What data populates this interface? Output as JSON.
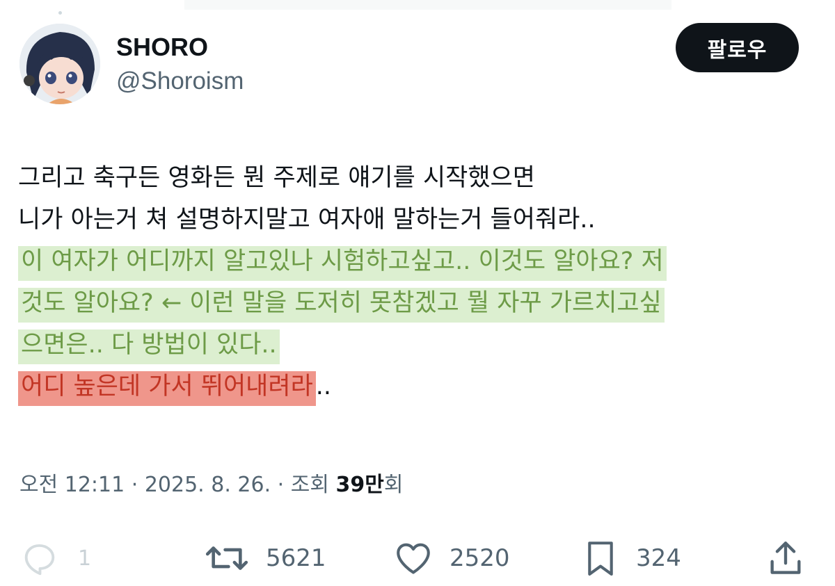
{
  "author": {
    "display_name": "SHORO",
    "handle": "@Shoroism"
  },
  "follow_button": {
    "label": "팔로우"
  },
  "tweet": {
    "lines": [
      {
        "text": "그리고 축구든 영화든 뭔 주제로 얘기를 시작했으면",
        "highlight": "none"
      },
      {
        "text": "니가 아는거 쳐 설명하지말고 여자애 말하는거 들어줘라..",
        "highlight": "none"
      },
      {
        "text": "이 여자가 어디까지 알고있나 시험하고싶고.. 이것도 알아요? 저",
        "highlight": "green"
      },
      {
        "text": "것도 알아요? ← 이런 말을 도저히 못참겠고 뭘 자꾸 가르치고싶",
        "highlight": "green"
      },
      {
        "text": "으면은.. 다 방법이 있다..",
        "highlight": "green"
      },
      {
        "text": "어디 높은데 가서 뛰어내려라",
        "suffix": "..",
        "highlight": "red"
      }
    ]
  },
  "meta": {
    "time": "오전 12:11",
    "separator": " · ",
    "date": "2025. 8. 26.",
    "views_label": "조회 ",
    "views_count": "39만",
    "views_suffix": "회"
  },
  "actions": {
    "replies": "1",
    "retweets": "5621",
    "likes": "2520",
    "bookmarks": "324"
  },
  "icons": {
    "reply": "reply-icon",
    "retweet": "retweet-icon",
    "like": "heart-icon",
    "bookmark": "bookmark-icon",
    "share": "share-icon"
  },
  "colors": {
    "text_primary": "#0f1419",
    "text_secondary": "#536471",
    "highlight_green_bg": "#dcefd0",
    "highlight_green_text": "#6d9b47",
    "highlight_red_bg": "#ef968b",
    "highlight_red_text": "#c23524",
    "follow_button_bg": "#0f1419"
  }
}
